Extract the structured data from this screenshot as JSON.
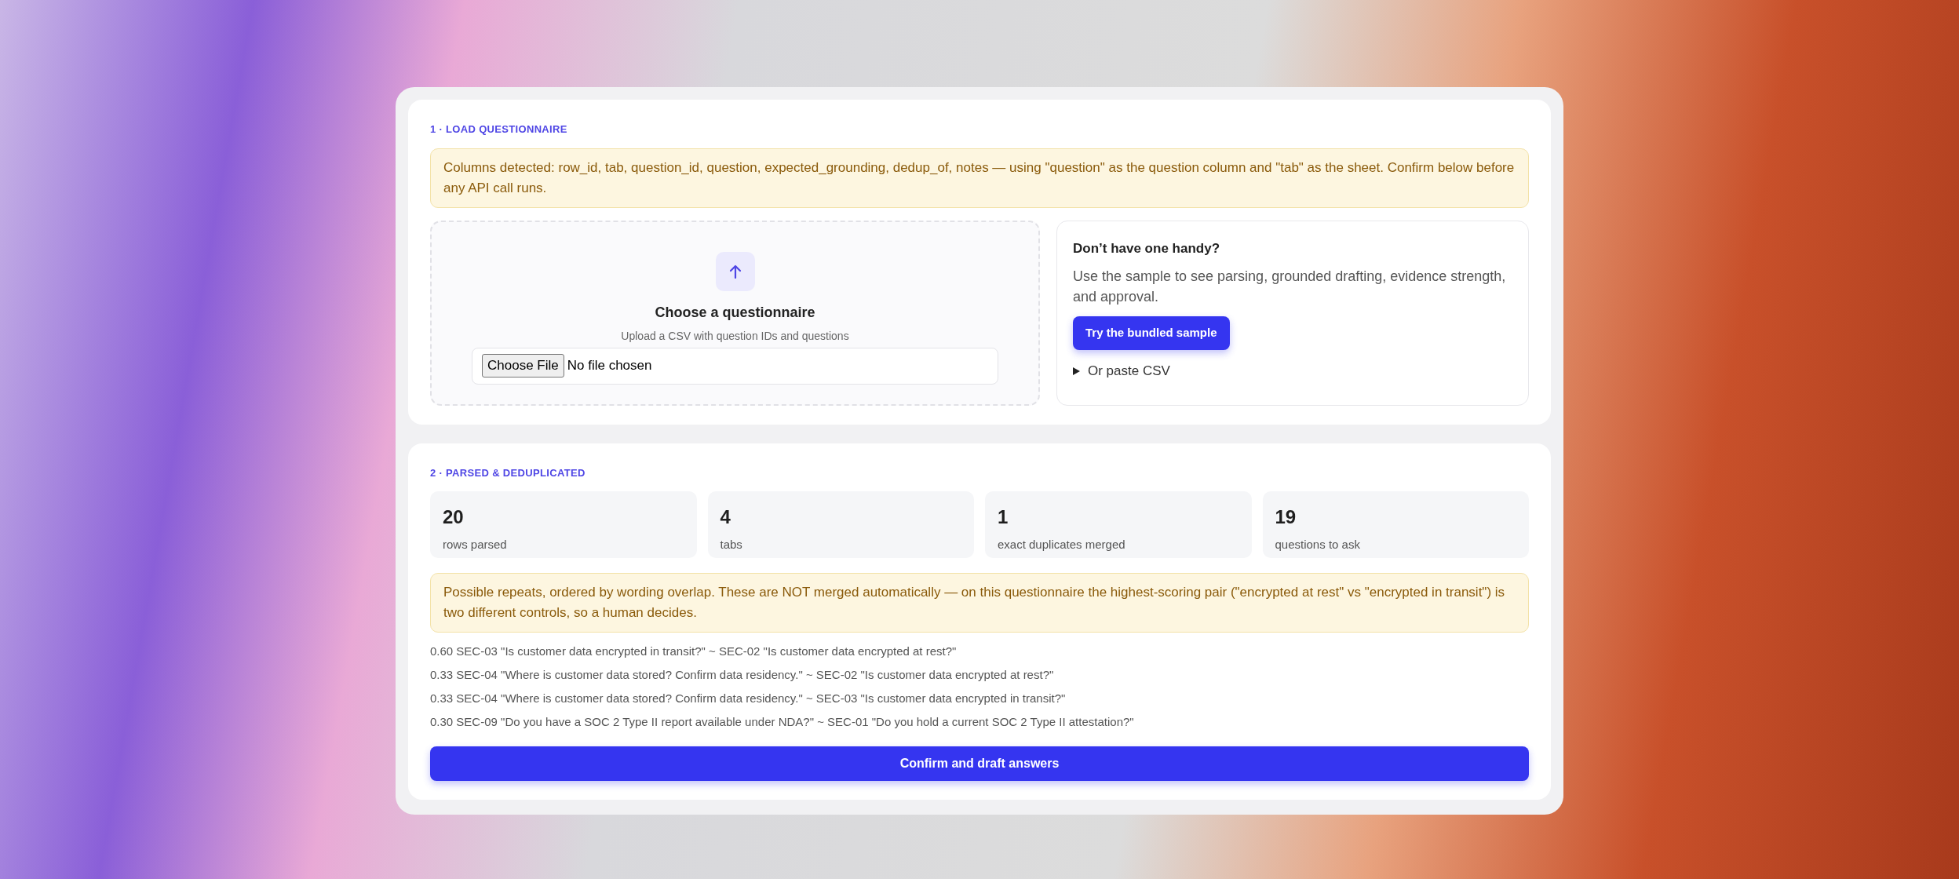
{
  "load_section": {
    "heading": "1 · LOAD QUESTIONNAIRE",
    "notice": "Columns detected: row_id, tab, question_id, question, expected_grounding, dedup_of, notes — using \"question\" as the question column and \"tab\" as the sheet. Confirm below before any API call runs.",
    "upload": {
      "title": "Choose a questionnaire",
      "hint": "Upload a CSV with question IDs and questions",
      "file_button": "Choose File",
      "file_status": "No file chosen"
    },
    "sample": {
      "title": "Don’t have one handy?",
      "text": "Use the sample to see parsing, grounded drafting, evidence strength, and approval.",
      "button": "Try the bundled sample",
      "paste_toggle": {
        "label": "Or paste CSV",
        "expanded": false
      }
    }
  },
  "parsed_section": {
    "heading": "2 · PARSED & DEDUPLICATED",
    "stats": [
      {
        "value": "20",
        "label": "rows parsed"
      },
      {
        "value": "4",
        "label": "tabs"
      },
      {
        "value": "1",
        "label": "exact duplicates merged"
      },
      {
        "value": "19",
        "label": "questions to ask"
      }
    ],
    "notice": "Possible repeats, ordered by wording overlap. These are NOT merged automatically — on this questionnaire the highest-scoring pair (\"encrypted at rest\" vs \"encrypted in transit\") is two different controls, so a human decides.",
    "repeats": [
      "0.60 SEC-03 \"Is customer data encrypted in transit?\" ~ SEC-02 \"Is customer data encrypted at rest?\"",
      "0.33 SEC-04 \"Where is customer data stored? Confirm data residency.\" ~ SEC-02 \"Is customer data encrypted at rest?\"",
      "0.33 SEC-04 \"Where is customer data stored? Confirm data residency.\" ~ SEC-03 \"Is customer data encrypted in transit?\"",
      "0.30 SEC-09 \"Do you have a SOC 2 Type II report available under NDA?\" ~ SEC-01 \"Do you hold a current SOC 2 Type II attestation?\""
    ],
    "confirm_button": "Confirm and draft answers"
  }
}
